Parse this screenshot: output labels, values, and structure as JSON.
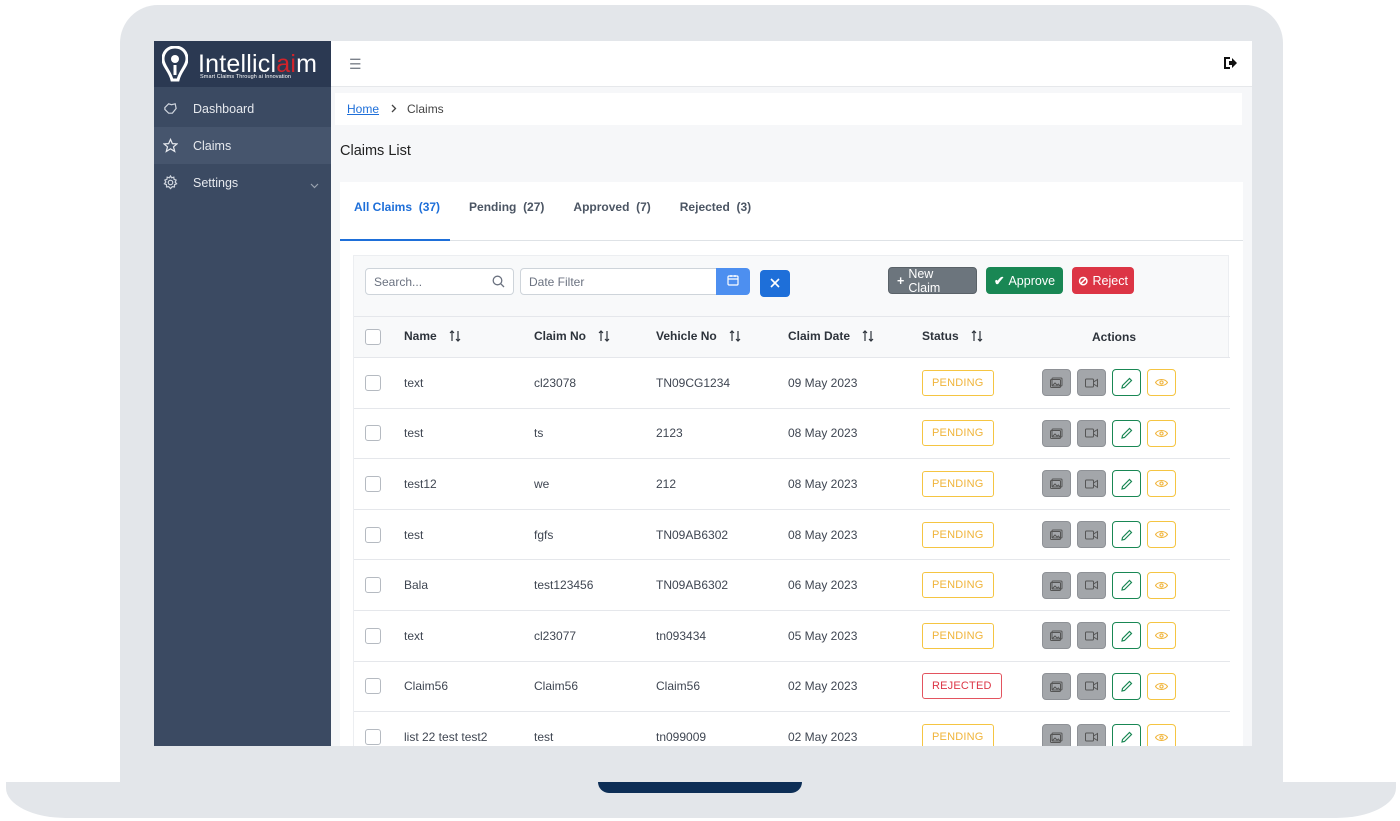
{
  "app": {
    "logo_main": "Intellicl",
    "logo_ai": "ai",
    "logo_end": "m",
    "logo_tagline": "Smart Claims Through ai Innovation"
  },
  "sidebar": {
    "items": [
      {
        "label": "Dashboard",
        "icon": "hand-icon"
      },
      {
        "label": "Claims",
        "icon": "star-icon"
      },
      {
        "label": "Settings",
        "icon": "gear-icon"
      }
    ]
  },
  "breadcrumb": {
    "home": "Home",
    "current": "Claims"
  },
  "page": {
    "title": "Claims List"
  },
  "tabs": [
    {
      "label": "All Claims",
      "count": "(37)"
    },
    {
      "label": "Pending",
      "count": "(27)"
    },
    {
      "label": "Approved",
      "count": "(7)"
    },
    {
      "label": "Rejected",
      "count": "(3)"
    }
  ],
  "toolbar": {
    "search_placeholder": "Search...",
    "date_placeholder": "Date Filter",
    "new_claim": "New Claim",
    "approve": "Approve",
    "reject": "Reject"
  },
  "table": {
    "headers": {
      "name": "Name",
      "claim_no": "Claim No",
      "vehicle_no": "Vehicle No",
      "claim_date": "Claim Date",
      "status": "Status",
      "actions": "Actions"
    },
    "rows": [
      {
        "name": "text",
        "claim_no": "cl23078",
        "vehicle_no": "TN09CG1234",
        "date": "09 May 2023",
        "status": "PENDING"
      },
      {
        "name": "test",
        "claim_no": "ts",
        "vehicle_no": "2123",
        "date": "08 May 2023",
        "status": "PENDING"
      },
      {
        "name": "test12",
        "claim_no": "we",
        "vehicle_no": "212",
        "date": "08 May 2023",
        "status": "PENDING"
      },
      {
        "name": "test",
        "claim_no": "fgfs",
        "vehicle_no": "TN09AB6302",
        "date": "08 May 2023",
        "status": "PENDING"
      },
      {
        "name": "Bala",
        "claim_no": "test123456",
        "vehicle_no": "TN09AB6302",
        "date": "06 May 2023",
        "status": "PENDING"
      },
      {
        "name": "text",
        "claim_no": "cl23077",
        "vehicle_no": "tn093434",
        "date": "05 May 2023",
        "status": "PENDING"
      },
      {
        "name": "Claim56",
        "claim_no": "Claim56",
        "vehicle_no": "Claim56",
        "date": "02 May 2023",
        "status": "REJECTED"
      },
      {
        "name": "list 22 test test2",
        "claim_no": "test",
        "vehicle_no": "tn099009",
        "date": "02 May 2023",
        "status": "PENDING"
      }
    ]
  },
  "colors": {
    "sidebar": "#3b4a62",
    "primary": "#1e6fd9",
    "approve": "#198754",
    "reject": "#dc3545",
    "pending": "#f0b43a"
  }
}
